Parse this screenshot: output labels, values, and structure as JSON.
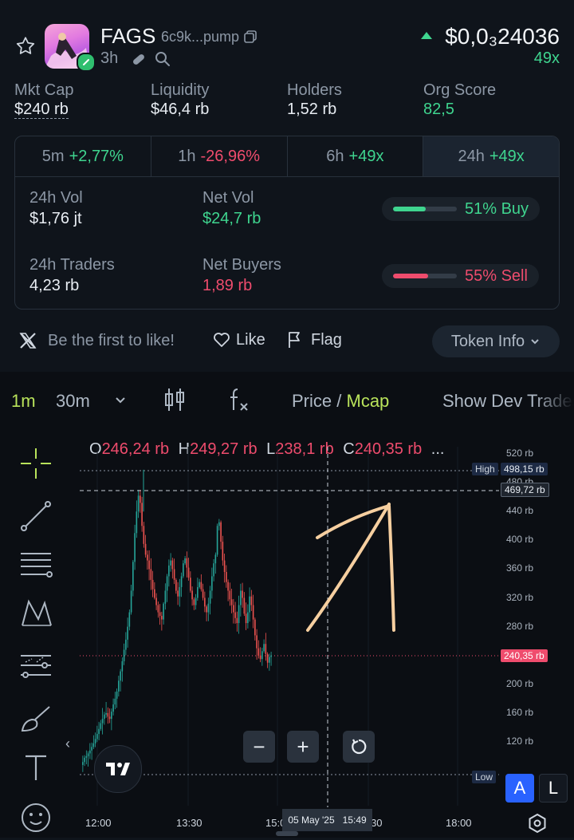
{
  "token": {
    "symbol": "FAGS",
    "address": "6c9k...pump",
    "age": "3h",
    "price": "$0,0₃24036",
    "change": "49x"
  },
  "stats": [
    {
      "label": "Mkt Cap",
      "value": "$240 rb",
      "tone": "white"
    },
    {
      "label": "Liquidity",
      "value": "$46,4 rb",
      "tone": "white"
    },
    {
      "label": "Holders",
      "value": "1,52 rb",
      "tone": "white"
    },
    {
      "label": "Org Score",
      "value": "82,5",
      "tone": "green"
    }
  ],
  "timeframes": [
    {
      "label": "5m",
      "value": "+2,77%",
      "tone": "green"
    },
    {
      "label": "1h",
      "value": "-26,96%",
      "tone": "red"
    },
    {
      "label": "6h",
      "value": "+49x",
      "tone": "green"
    },
    {
      "label": "24h",
      "value": "+49x",
      "tone": "green"
    }
  ],
  "metrics": {
    "vol_label": "24h Vol",
    "vol_value": "$1,76 jt",
    "netvol_label": "Net Vol",
    "netvol_value": "$24,7 rb",
    "traders_label": "24h Traders",
    "traders_value": "4,23 rb",
    "netbuyers_label": "Net Buyers",
    "netbuyers_value": "1,89 rb",
    "buy_text": "51% Buy",
    "buy_pct": 0.51,
    "sell_text": "55% Sell",
    "sell_pct": 0.55
  },
  "social": {
    "like_prompt": "Be the first to like!",
    "like_label": "Like",
    "flag_label": "Flag",
    "token_info_label": "Token Info"
  },
  "chart_toolbar": {
    "interval_1": "1m",
    "interval_2": "30m",
    "price_label": "Price",
    "separator": "/",
    "mcap_label": "Mcap",
    "dev_label": "Show Dev Trades"
  },
  "ohlc": {
    "o_key": "O",
    "o_val": "246,24 rb",
    "h_key": "H",
    "h_val": "249,27 rb",
    "l_key": "L",
    "l_val": "238,1 rb",
    "c_key": "C",
    "c_val": "240,35 rb",
    "more": "..."
  },
  "chart_data": {
    "type": "candlestick",
    "x_ticks": [
      "12:00",
      "13:30",
      "15:00",
      "16:30",
      "18:00"
    ],
    "y_ticks": [
      "520 rb",
      "480 rb",
      "440 rb",
      "400 rb",
      "360 rb",
      "320 rb",
      "280 rb",
      "240 rb",
      "200 rb",
      "160 rb",
      "120 rb"
    ],
    "high_label": "High",
    "high_value": "498,15 rb",
    "crosshair_value": "469,72 rb",
    "last_value": "240,35 rb",
    "low_label": "Low",
    "crosshair_time": "05 May '25   15:49",
    "close_path_k": [
      88,
      92,
      98,
      100,
      104,
      108,
      113,
      118,
      124,
      131,
      138,
      146,
      152,
      158,
      160,
      155,
      152,
      162,
      172,
      180,
      190,
      205,
      218,
      232,
      248,
      262,
      280,
      300,
      330,
      370,
      410,
      440,
      462,
      452,
      420,
      395,
      380,
      372,
      360,
      345,
      332,
      320,
      310,
      300,
      295,
      290,
      312,
      330,
      350,
      365,
      372,
      360,
      345,
      330,
      322,
      335,
      350,
      368,
      375,
      362,
      348,
      330,
      318,
      310,
      320,
      335,
      342,
      332,
      320,
      308,
      300,
      312,
      330,
      350,
      368,
      380,
      420,
      425,
      398,
      372,
      356,
      342,
      330,
      318,
      310,
      300,
      292,
      285,
      310,
      330,
      320,
      298,
      285,
      300,
      322,
      310,
      290,
      268,
      250,
      240,
      235,
      246,
      256,
      242,
      230,
      238,
      240
    ]
  },
  "chart_controls": {
    "zoom_out": "−",
    "zoom_in": "+",
    "auto_label": "A",
    "log_label": "L"
  }
}
